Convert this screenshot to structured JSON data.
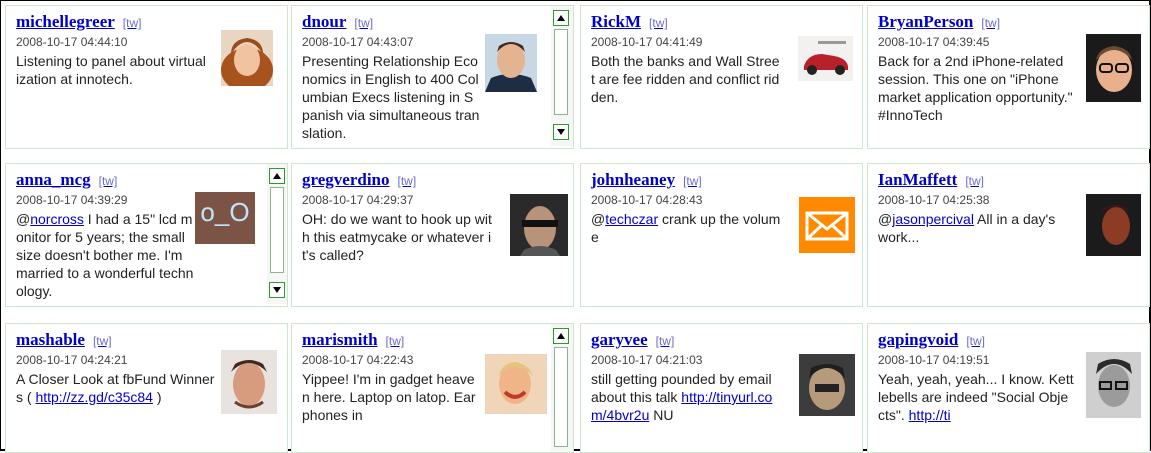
{
  "tw_tag": "[tw]",
  "tweets": [
    {
      "user": "michellegreer",
      "time": "2008-10-17 04:44:10",
      "text": [
        "Listening to panel about virtualization at innotech."
      ]
    },
    {
      "user": "dnour",
      "time": "2008-10-17 04:43:07",
      "text": [
        "Presenting Relationship Economics in English to 400 Columbian Execs listening in Spanish via ",
        "simultaneous translation."
      ]
    },
    {
      "user": "RickM",
      "time": "2008-10-17 04:41:49",
      "text": [
        "Both the banks and Wall Street are fee ridden and conflict ridden."
      ]
    },
    {
      "user": "BryanPerson",
      "time": "2008-10-17 04:39:45",
      "text": [
        "Back for a 2nd iPhone-related session. This one on \"iPhone market application opportunity.\" #InnoTech"
      ]
    },
    {
      "user": "anna_mcg",
      "time": "2008-10-17 04:39:29",
      "text": [
        "@",
        "norcross",
        " I had a 15\" lcd monitor for 5 years; the small size doesn't bother me. I'm married to a ",
        "wonderful technology."
      ],
      "avatar_text": "o_O"
    },
    {
      "user": "gregverdino",
      "time": "2008-10-17 04:29:37",
      "text": [
        "OH: do we want to hook up with this eatmycake or whatever it's called?"
      ]
    },
    {
      "user": "johnheaney",
      "time": "2008-10-17 04:28:43",
      "text": [
        "@",
        "techczar",
        " crank up the volume"
      ]
    },
    {
      "user": "IanMaffett",
      "time": "2008-10-17 04:25:38",
      "text": [
        "@",
        "jasonpercival",
        " All in a day's work..."
      ]
    },
    {
      "user": "mashable",
      "time": "2008-10-17 04:24:21",
      "text": [
        "A Closer Look at fbFund Winners ( ",
        "http://zz.gd/c35c84",
        " )"
      ]
    },
    {
      "user": "marismith",
      "time": "2008-10-17 04:22:43",
      "text": [
        "Yippee! I'm in gadget heaven here. Laptop on latop. Earphones in"
      ]
    },
    {
      "user": "garyvee",
      "time": "2008-10-17 04:21:03",
      "text": [
        "still getting pounded by email about this talk ",
        "http://tinyurl.com/4bvr2u",
        " NU"
      ]
    },
    {
      "user": "gapingvoid",
      "time": "2008-10-17 04:19:51",
      "text": [
        "Yeah, yeah, yeah... I know. Kettlebells are indeed \"Social Objects\". ",
        "http://ti"
      ]
    }
  ]
}
